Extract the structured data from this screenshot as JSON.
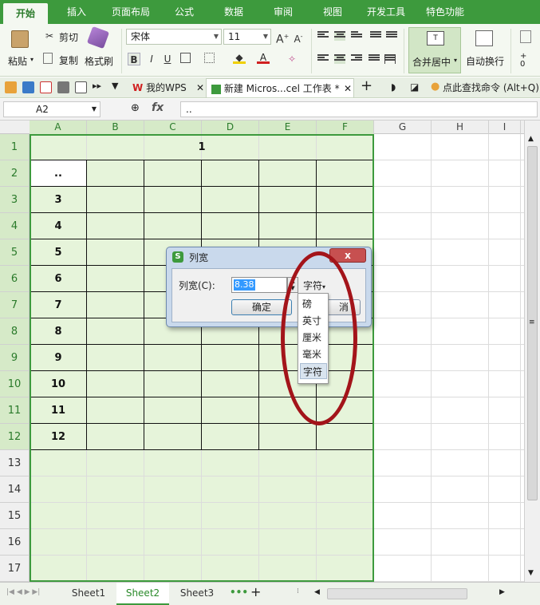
{
  "ribbon_tabs": [
    "开始",
    "插入",
    "页面布局",
    "公式",
    "数据",
    "审阅",
    "视图",
    "开发工具",
    "特色功能"
  ],
  "ribbon": {
    "paste": "粘贴",
    "cut": "剪切",
    "copy": "复制",
    "format_painter": "格式刷",
    "font_name": "宋体",
    "font_size": "11",
    "merge_center": "合并居中",
    "auto_wrap": "自动换行"
  },
  "doc_tabs": {
    "mywps": "我的WPS",
    "file": "新建 Micros...cel 工作表 *",
    "search": "点此查找命令 (Alt+Q)"
  },
  "formula_bar": {
    "name_box": "A2",
    "fx": "fx",
    "value": ".."
  },
  "columns": [
    "A",
    "B",
    "C",
    "D",
    "E",
    "F",
    "G",
    "H",
    "I"
  ],
  "rows": [
    "1",
    "2",
    "3",
    "4",
    "5",
    "6",
    "7",
    "8",
    "9",
    "10",
    "11",
    "12",
    "13",
    "14",
    "15",
    "16",
    "17"
  ],
  "cells": {
    "A1": "1",
    "A2": "..",
    "A3": "3",
    "A4": "4",
    "A5": "5",
    "A6": "6",
    "A7": "7",
    "A8": "8",
    "A9": "9",
    "A10": "10",
    "A11": "11",
    "A12": "12"
  },
  "sheets": [
    "Sheet1",
    "Sheet2",
    "Sheet3"
  ],
  "active_sheet": "Sheet2",
  "dialog": {
    "title": "列宽",
    "label": "列宽(C):",
    "value": "8.38",
    "unit": "字符",
    "ok": "确定",
    "cancel": "消",
    "close": "x"
  },
  "unit_options": [
    "磅",
    "英寸",
    "厘米",
    "毫米",
    "字符"
  ],
  "selected_unit": "字符",
  "colors": {
    "accent": "#3d9a3d",
    "selection_fill": "#e6f4da",
    "annotation": "#a3141a"
  }
}
